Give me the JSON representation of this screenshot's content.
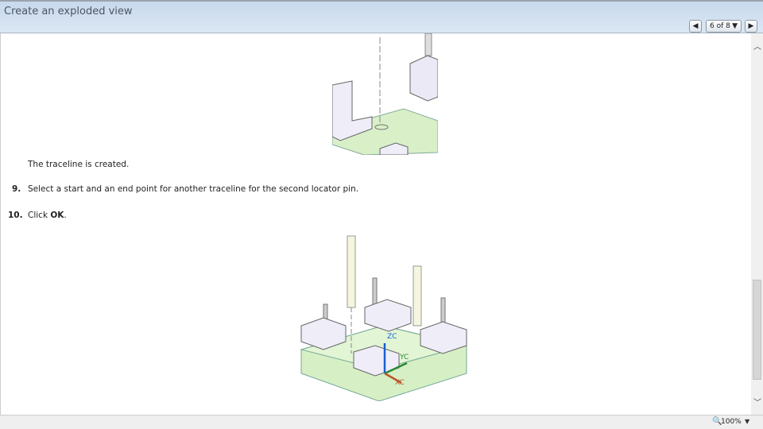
{
  "window": {
    "title": "Create an exploded view"
  },
  "pager": {
    "prev_icon": "triangle-left-icon",
    "label": "6 of 8",
    "dropdown_icon": "triangle-down-icon",
    "next_icon": "triangle-right-icon"
  },
  "content": {
    "caption": "The traceline is created.",
    "steps": [
      {
        "number": "9.",
        "text": "Select a start and an end point for another traceline for the second locator pin."
      },
      {
        "number": "10.",
        "text_prefix": "Click ",
        "text_bold": "OK",
        "text_suffix": "."
      }
    ],
    "axis_labels": {
      "z": "ZC",
      "y": "YC",
      "x": "XC"
    }
  },
  "status": {
    "zoom": "100%"
  }
}
